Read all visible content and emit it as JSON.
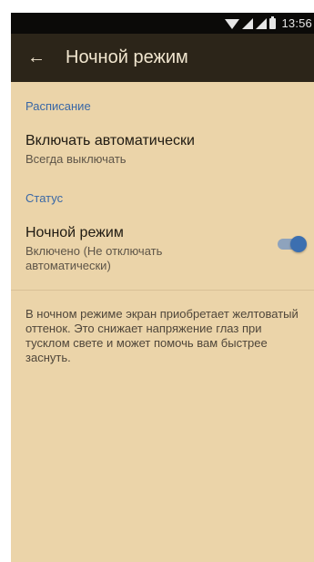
{
  "statusbar": {
    "time": "13:56",
    "icons": [
      "wifi-icon",
      "signal-icon",
      "signal-icon",
      "battery-icon"
    ]
  },
  "toolbar": {
    "back_icon": "arrow-left-icon",
    "back_glyph": "←",
    "title": "Ночной режим"
  },
  "sections": {
    "schedule": {
      "header": "Расписание",
      "auto": {
        "title": "Включать автоматически",
        "summary": "Всегда выключать"
      }
    },
    "status": {
      "header": "Статус",
      "night_mode": {
        "title": "Ночной режим",
        "summary": "Включено (Не отключать автоматически)",
        "switch_on": true
      }
    }
  },
  "description": "В ночном режиме экран приобретает желтоватый оттенок. Это снижает напряжение глаз при тусклом свете и может помочь вам быстрее заснуть.",
  "colors": {
    "background": "#ebd4a9",
    "toolbar": "#2c2519",
    "statusbar": "#0b0a08",
    "accent": "#3c6fb0"
  }
}
